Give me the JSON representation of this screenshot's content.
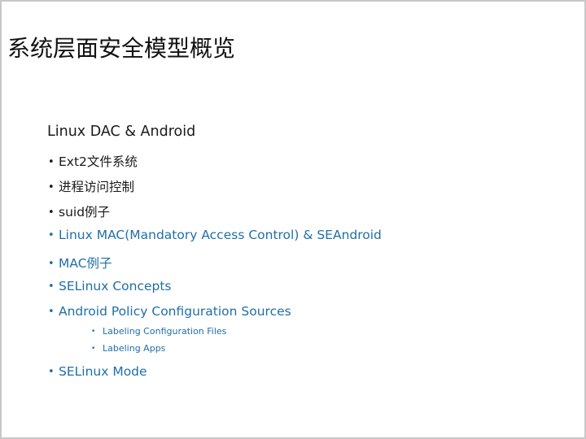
{
  "slide": {
    "title": "系统层面安全模型概览",
    "heading": "Linux DAC & Android",
    "bullet_glyph": "•",
    "items": [
      {
        "label": "Ext2文件系统",
        "level": 1,
        "color": "#1a1a1a"
      },
      {
        "label": "进程访问控制",
        "level": 1,
        "color": "#1a1a1a"
      },
      {
        "label": "suid例子",
        "level": 1,
        "color": "#1a1a1a"
      },
      {
        "label": "Linux MAC(Mandatory Access Control) & SEAndroid",
        "level": 1,
        "color": "#1f6fa8"
      },
      {
        "label": "MAC例子",
        "level": 1,
        "color": "#1f6fa8"
      },
      {
        "label": "SELinux Concepts",
        "level": 1,
        "color": "#1f6fa8"
      },
      {
        "label": "Android Policy Configuration Sources",
        "level": 1,
        "color": "#1f6fa8"
      },
      {
        "label": "Labeling Configuration Files",
        "level": 2,
        "color": "#1f6fa8"
      },
      {
        "label": "Labeling Apps",
        "level": 2,
        "color": "#1f6fa8"
      },
      {
        "label": "SELinux Mode",
        "level": 1,
        "color": "#1f6fa8"
      }
    ]
  }
}
